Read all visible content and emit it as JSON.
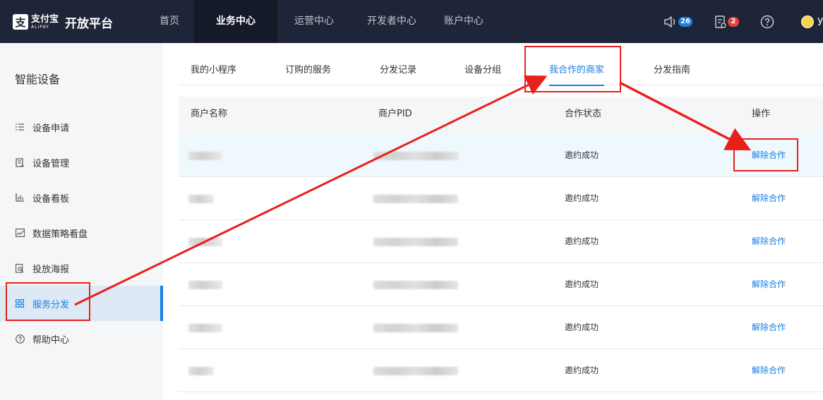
{
  "header": {
    "logo_cn": "支付宝",
    "logo_en": "ALIPAY",
    "brand_title": "开放平台",
    "nav": [
      {
        "label": "首页",
        "active": false
      },
      {
        "label": "业务中心",
        "active": true
      },
      {
        "label": "运营中心",
        "active": false
      },
      {
        "label": "开发者中心",
        "active": false
      },
      {
        "label": "账户中心",
        "active": false
      }
    ],
    "notifications_count": "26",
    "messages_count": "2",
    "help_icon": "question-circle-icon",
    "user_initial": "y"
  },
  "sidebar": {
    "title": "智能设备",
    "items": [
      {
        "label": "设备申请",
        "icon": "list-icon",
        "active": false
      },
      {
        "label": "设备管理",
        "icon": "device-doc-icon",
        "active": false
      },
      {
        "label": "设备看板",
        "icon": "bar-chart-icon",
        "active": false
      },
      {
        "label": "数据策略看盘",
        "icon": "line-chart-icon",
        "active": false
      },
      {
        "label": "投放海报",
        "icon": "poster-search-icon",
        "active": false
      },
      {
        "label": "服务分发",
        "icon": "grid-icon",
        "active": true
      },
      {
        "label": "帮助中心",
        "icon": "question-circle-icon",
        "active": false
      }
    ]
  },
  "tabs": [
    {
      "label": "我的小程序",
      "active": false
    },
    {
      "label": "订购的服务",
      "active": false
    },
    {
      "label": "分发记录",
      "active": false
    },
    {
      "label": "设备分组",
      "active": false
    },
    {
      "label": "我合作的商家",
      "active": true
    },
    {
      "label": "分发指南",
      "active": false
    }
  ],
  "table": {
    "columns": [
      "商户名称",
      "商户PID",
      "合作状态",
      "操作"
    ],
    "rows": [
      {
        "status": "邀约成功",
        "action": "解除合作",
        "highlighted": true
      },
      {
        "status": "邀约成功",
        "action": "解除合作",
        "highlighted": false
      },
      {
        "status": "邀约成功",
        "action": "解除合作",
        "highlighted": false
      },
      {
        "status": "邀约成功",
        "action": "解除合作",
        "highlighted": false
      },
      {
        "status": "邀约成功",
        "action": "解除合作",
        "highlighted": false
      },
      {
        "status": "邀约成功",
        "action": "解除合作",
        "highlighted": false
      }
    ]
  },
  "colors": {
    "topbar": "#1f2538",
    "accent": "#1a7fe3",
    "annotation": "#e8201c",
    "badge_blue": "#1a7fe3",
    "badge_red": "#e8413a"
  }
}
